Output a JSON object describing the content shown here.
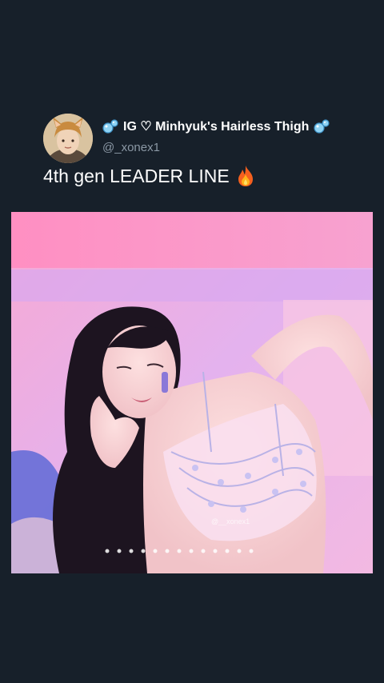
{
  "tweet": {
    "display_name_prefix_icon": "bubbles-icon",
    "display_name": "IG ♡ Minhyuk's Hairless Thigh",
    "display_name_suffix_icon": "bubbles-icon",
    "handle": "@_xonex1",
    "text": "4th gen LEADER LINE",
    "text_emoji": "fire-icon"
  },
  "media": {
    "description_icon": "photo-performer-image",
    "watermark": "@__xonex1"
  },
  "colors": {
    "background": "#17202a",
    "name_text": "#ffffff",
    "handle_text": "#8b98a5",
    "media_pink": "#f4a6d8"
  }
}
